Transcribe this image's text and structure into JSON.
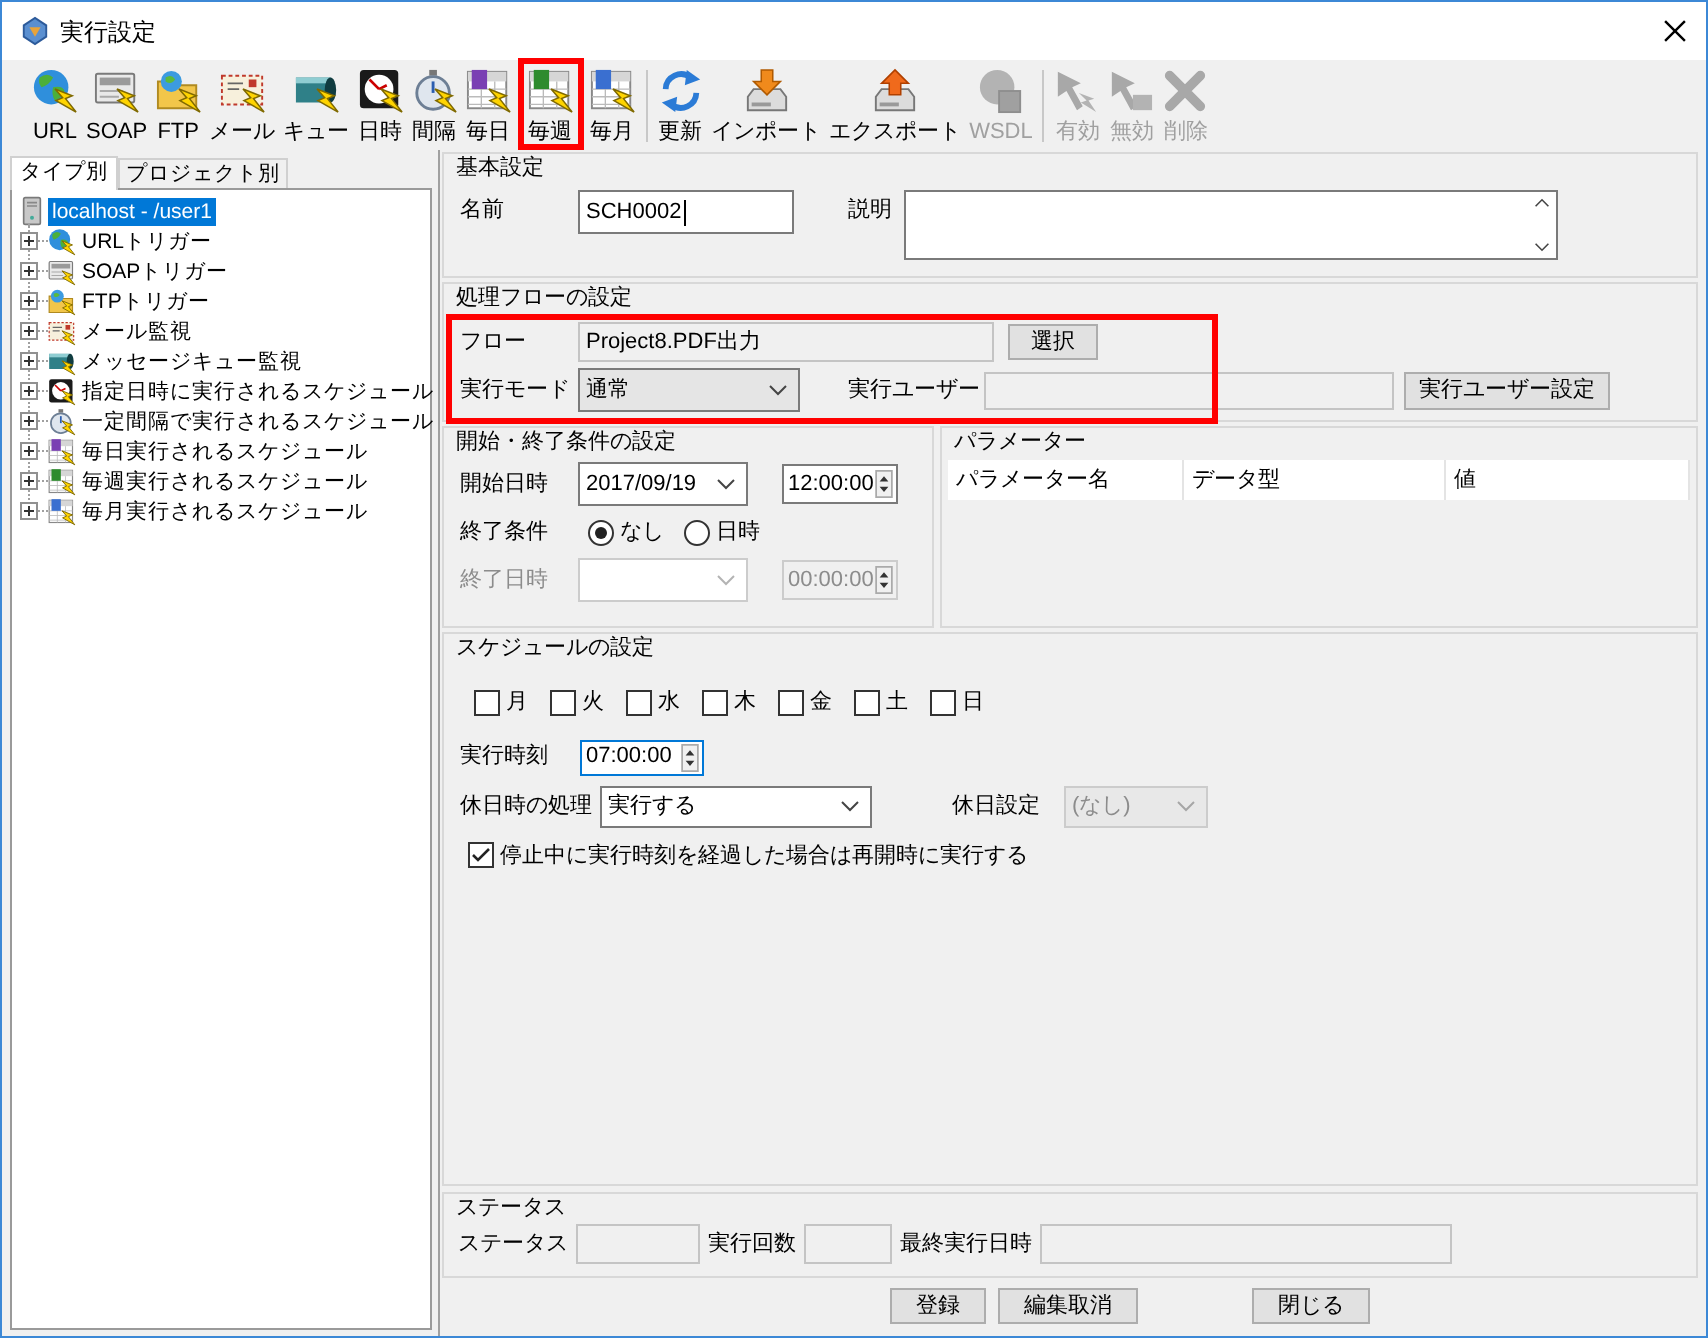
{
  "window": {
    "title": "実行設定"
  },
  "toolbar": {
    "groups": [
      [
        {
          "label": "URL",
          "kind": "url",
          "disabled": false,
          "highlighted": false
        },
        {
          "label": "SOAP",
          "kind": "soap",
          "disabled": false,
          "highlighted": false
        },
        {
          "label": "FTP",
          "kind": "ftp",
          "disabled": false,
          "highlighted": false
        },
        {
          "label": "メール",
          "kind": "mail",
          "disabled": false,
          "highlighted": false
        },
        {
          "label": "キュー",
          "kind": "queue",
          "disabled": false,
          "highlighted": false
        },
        {
          "label": "日時",
          "kind": "datetime",
          "disabled": false,
          "highlighted": false
        },
        {
          "label": "間隔",
          "kind": "interval",
          "disabled": false,
          "highlighted": false
        },
        {
          "label": "毎日",
          "kind": "daily",
          "disabled": false,
          "highlighted": false
        },
        {
          "label": "毎週",
          "kind": "weekly",
          "disabled": false,
          "highlighted": true
        },
        {
          "label": "毎月",
          "kind": "monthly",
          "disabled": false,
          "highlighted": false
        }
      ],
      [
        {
          "label": "更新",
          "kind": "refresh",
          "disabled": false,
          "highlighted": false
        },
        {
          "label": "インポート",
          "kind": "import",
          "disabled": false,
          "highlighted": false
        },
        {
          "label": "エクスポート",
          "kind": "export",
          "disabled": false,
          "highlighted": false
        },
        {
          "label": "WSDL",
          "kind": "wsdl",
          "disabled": true,
          "highlighted": false
        }
      ],
      [
        {
          "label": "有効",
          "kind": "enable",
          "disabled": true,
          "highlighted": false
        },
        {
          "label": "無効",
          "kind": "disable",
          "disabled": true,
          "highlighted": false
        },
        {
          "label": "削除",
          "kind": "delete",
          "disabled": true,
          "highlighted": false
        }
      ]
    ]
  },
  "left_panel": {
    "tabs": [
      {
        "label": "タイプ別",
        "selected": true
      },
      {
        "label": "プロジェクト別",
        "selected": false
      }
    ],
    "tree": {
      "label": "localhost - /user1",
      "selected": true,
      "children": [
        {
          "label": "URLトリガー",
          "kind": "url",
          "expanded": false,
          "selected": false
        },
        {
          "label": "SOAPトリガー",
          "kind": "soap",
          "expanded": false,
          "selected": false
        },
        {
          "label": "FTPトリガー",
          "kind": "ftp",
          "expanded": false,
          "selected": false
        },
        {
          "label": "メール監視",
          "kind": "mail",
          "expanded": false,
          "selected": false
        },
        {
          "label": "メッセージキュー監視",
          "kind": "queue",
          "expanded": false,
          "selected": false
        },
        {
          "label": "指定日時に実行されるスケジュール",
          "kind": "datetime",
          "expanded": false,
          "selected": false
        },
        {
          "label": "一定間隔で実行されるスケジュール",
          "kind": "interval",
          "expanded": false,
          "selected": false
        },
        {
          "label": "毎日実行されるスケジュール",
          "kind": "daily",
          "expanded": false,
          "selected": false
        },
        {
          "label": "毎週実行されるスケジュール",
          "kind": "weekly",
          "expanded": false,
          "selected": false
        },
        {
          "label": "毎月実行されるスケジュール",
          "kind": "monthly",
          "expanded": false,
          "selected": false
        }
      ]
    }
  },
  "basic_settings": {
    "title": "基本設定",
    "name_label": "名前",
    "name_value": "SCH0002",
    "description_label": "説明"
  },
  "flow_settings": {
    "title": "処理フローの設定",
    "highlighted": true,
    "flow_label": "フロー",
    "flow_value": "Project8.PDF出力",
    "select_button": "選択",
    "mode_label": "実行モード",
    "mode_value": "通常",
    "user_label": "実行ユーザー",
    "user_button": "実行ユーザー設定"
  },
  "conditions": {
    "title": "開始・終了条件の設定",
    "start_label": "開始日時",
    "start_date": "2017/09/19",
    "start_time": "12:00:00",
    "end_condition_label": "終了条件",
    "end_options": [
      {
        "label": "なし",
        "selected": true
      },
      {
        "label": "日時",
        "selected": false
      }
    ],
    "end_label": "終了日時",
    "end_time": "00:00:00",
    "end_disabled": true
  },
  "parameters": {
    "title": "パラメーター",
    "columns": [
      "パラメーター名",
      "データ型",
      "値"
    ]
  },
  "schedule": {
    "title": "スケジュールの設定",
    "days": [
      {
        "label": "月",
        "checked": false
      },
      {
        "label": "火",
        "checked": false
      },
      {
        "label": "水",
        "checked": false
      },
      {
        "label": "木",
        "checked": false
      },
      {
        "label": "金",
        "checked": false
      },
      {
        "label": "土",
        "checked": false
      },
      {
        "label": "日",
        "checked": false
      }
    ],
    "time_label": "実行時刻",
    "time_value": "07:00:00",
    "holiday_label": "休日時の処理",
    "holiday_value": "実行する",
    "holiday_setting_label": "休日設定",
    "holiday_setting_value": "(なし)",
    "holiday_setting_disabled": true,
    "resume": {
      "label": "停止中に実行時刻を経過した場合は再開時に実行する",
      "checked": true
    }
  },
  "status": {
    "title": "ステータス",
    "fields": [
      {
        "label": "ステータス"
      },
      {
        "label": "実行回数"
      },
      {
        "label": "最終実行日時"
      }
    ]
  },
  "button_groups": [
    [
      "登録",
      "編集取消"
    ],
    [
      "閉じる"
    ]
  ]
}
